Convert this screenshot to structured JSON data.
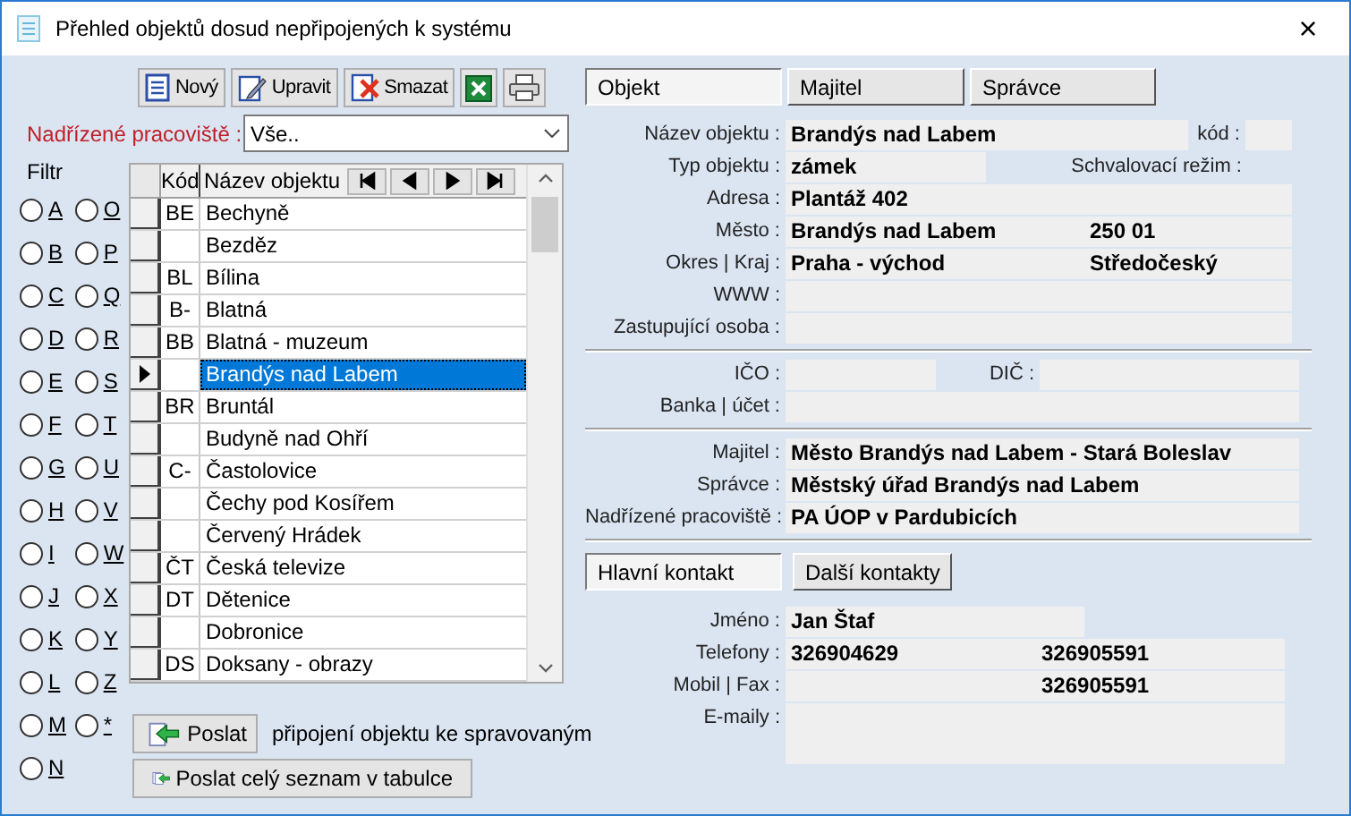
{
  "window": {
    "title": "Přehled objektů dosud nepřipojených k systému",
    "close": "×"
  },
  "toolbar": [
    {
      "kind": "new",
      "label": "Nový"
    },
    {
      "kind": "edit",
      "label": "Upravit"
    },
    {
      "kind": "delete",
      "label": "Smazat"
    },
    {
      "kind": "excel"
    },
    {
      "kind": "print"
    }
  ],
  "superior_filter": {
    "label": "Nadřízené pracoviště :",
    "value": "Vše.."
  },
  "filter": {
    "label": "Filtr",
    "options": [
      {
        "label": "A",
        "selected": false
      },
      {
        "label": "B",
        "selected": false
      },
      {
        "label": "C",
        "selected": false
      },
      {
        "label": "D",
        "selected": false
      },
      {
        "label": "E",
        "selected": false
      },
      {
        "label": "F",
        "selected": false
      },
      {
        "label": "G",
        "selected": false
      },
      {
        "label": "H",
        "selected": false
      },
      {
        "label": "I",
        "selected": false
      },
      {
        "label": "J",
        "selected": false
      },
      {
        "label": "K",
        "selected": false
      },
      {
        "label": "L",
        "selected": false
      },
      {
        "label": "M",
        "selected": false
      },
      {
        "label": "N",
        "selected": false
      },
      {
        "label": "O",
        "selected": false
      },
      {
        "label": "P",
        "selected": false
      },
      {
        "label": "Q",
        "selected": false
      },
      {
        "label": "R",
        "selected": false
      },
      {
        "label": "S",
        "selected": false
      },
      {
        "label": "T",
        "selected": false
      },
      {
        "label": "U",
        "selected": false
      },
      {
        "label": "V",
        "selected": false
      },
      {
        "label": "W",
        "selected": false
      },
      {
        "label": "X",
        "selected": false
      },
      {
        "label": "Y",
        "selected": false
      },
      {
        "label": "Z",
        "selected": false
      },
      {
        "label": "*",
        "selected": false
      }
    ]
  },
  "grid": {
    "columns": [
      "Kód",
      "Název objektu"
    ],
    "rows": [
      {
        "code": "BE",
        "name": "Bechyně",
        "selected": false
      },
      {
        "name": "Bezděz",
        "selected": false
      },
      {
        "code": "BL",
        "name": "Bílina",
        "selected": false
      },
      {
        "code": "B-",
        "name": "Blatná",
        "selected": false
      },
      {
        "code": "BB",
        "name": "Blatná - muzeum",
        "selected": false
      },
      {
        "name": "Brandýs nad Labem",
        "selected": true
      },
      {
        "code": "BR",
        "name": "Bruntál",
        "selected": false
      },
      {
        "name": "Budyně nad Ohří",
        "selected": false
      },
      {
        "code": "C-",
        "name": "Častolovice",
        "selected": false
      },
      {
        "name": "Čechy pod Kosířem",
        "selected": false
      },
      {
        "name": "Červený Hrádek",
        "selected": false
      },
      {
        "code": "ČT",
        "name": "Česká televize",
        "selected": false
      },
      {
        "code": "DT",
        "name": "Dětenice",
        "selected": false
      },
      {
        "name": "Dobronice",
        "selected": false
      },
      {
        "code": "DS",
        "name": "Doksany - obrazy",
        "selected": false
      }
    ]
  },
  "send": {
    "button": "Poslat",
    "note": "připojení objektu ke spravovaným",
    "all_button": "Poslat celý seznam v tabulce"
  },
  "tabs": [
    {
      "label": "Objekt",
      "selected": true
    },
    {
      "label": "Majitel",
      "selected": false
    },
    {
      "label": "Správce",
      "selected": false
    }
  ],
  "object": {
    "name": {
      "label": "Název objektu :",
      "value": "Brandýs nad Labem",
      "code_label": "kód :"
    },
    "type": {
      "label": "Typ objektu :",
      "value": "zámek",
      "mode_label": "Schvalovací režim :"
    },
    "address": {
      "label": "Adresa :",
      "value": "Plantáž 402"
    },
    "city": {
      "label": "Město :",
      "value": "Brandýs nad Labem",
      "zip": "250 01"
    },
    "district": {
      "label": "Okres | Kraj :",
      "value": "Praha - východ",
      "region": "Středočeský"
    },
    "www": {
      "label": "WWW :"
    },
    "representative": {
      "label": "Zastupující osoba :"
    },
    "ico": {
      "label": "IČO :",
      "dic_label": "DIČ :"
    },
    "bank": {
      "label": "Banka | účet :"
    },
    "owner": {
      "label": "Majitel :",
      "value": "Město Brandýs nad Labem - Stará Boleslav"
    },
    "manager": {
      "label": "Správce :",
      "value": "Městský úřad Brandýs nad Labem"
    },
    "superior": {
      "label": "Nadřízené pracoviště :",
      "value": "PA ÚOP v Pardubicích"
    }
  },
  "contact_tabs": [
    {
      "label": "Hlavní kontakt",
      "selected": true
    },
    {
      "label": "Další kontakty",
      "selected": false
    }
  ],
  "contact": {
    "name": {
      "label": "Jméno :",
      "value": "Jan Štaf"
    },
    "phones": {
      "label": "Telefony :",
      "values": [
        "326904629",
        "326905591"
      ]
    },
    "mobile_fax": {
      "label": "Mobil | Fax :",
      "fax": "326905591"
    },
    "emails": {
      "label": "E-maily :"
    }
  }
}
